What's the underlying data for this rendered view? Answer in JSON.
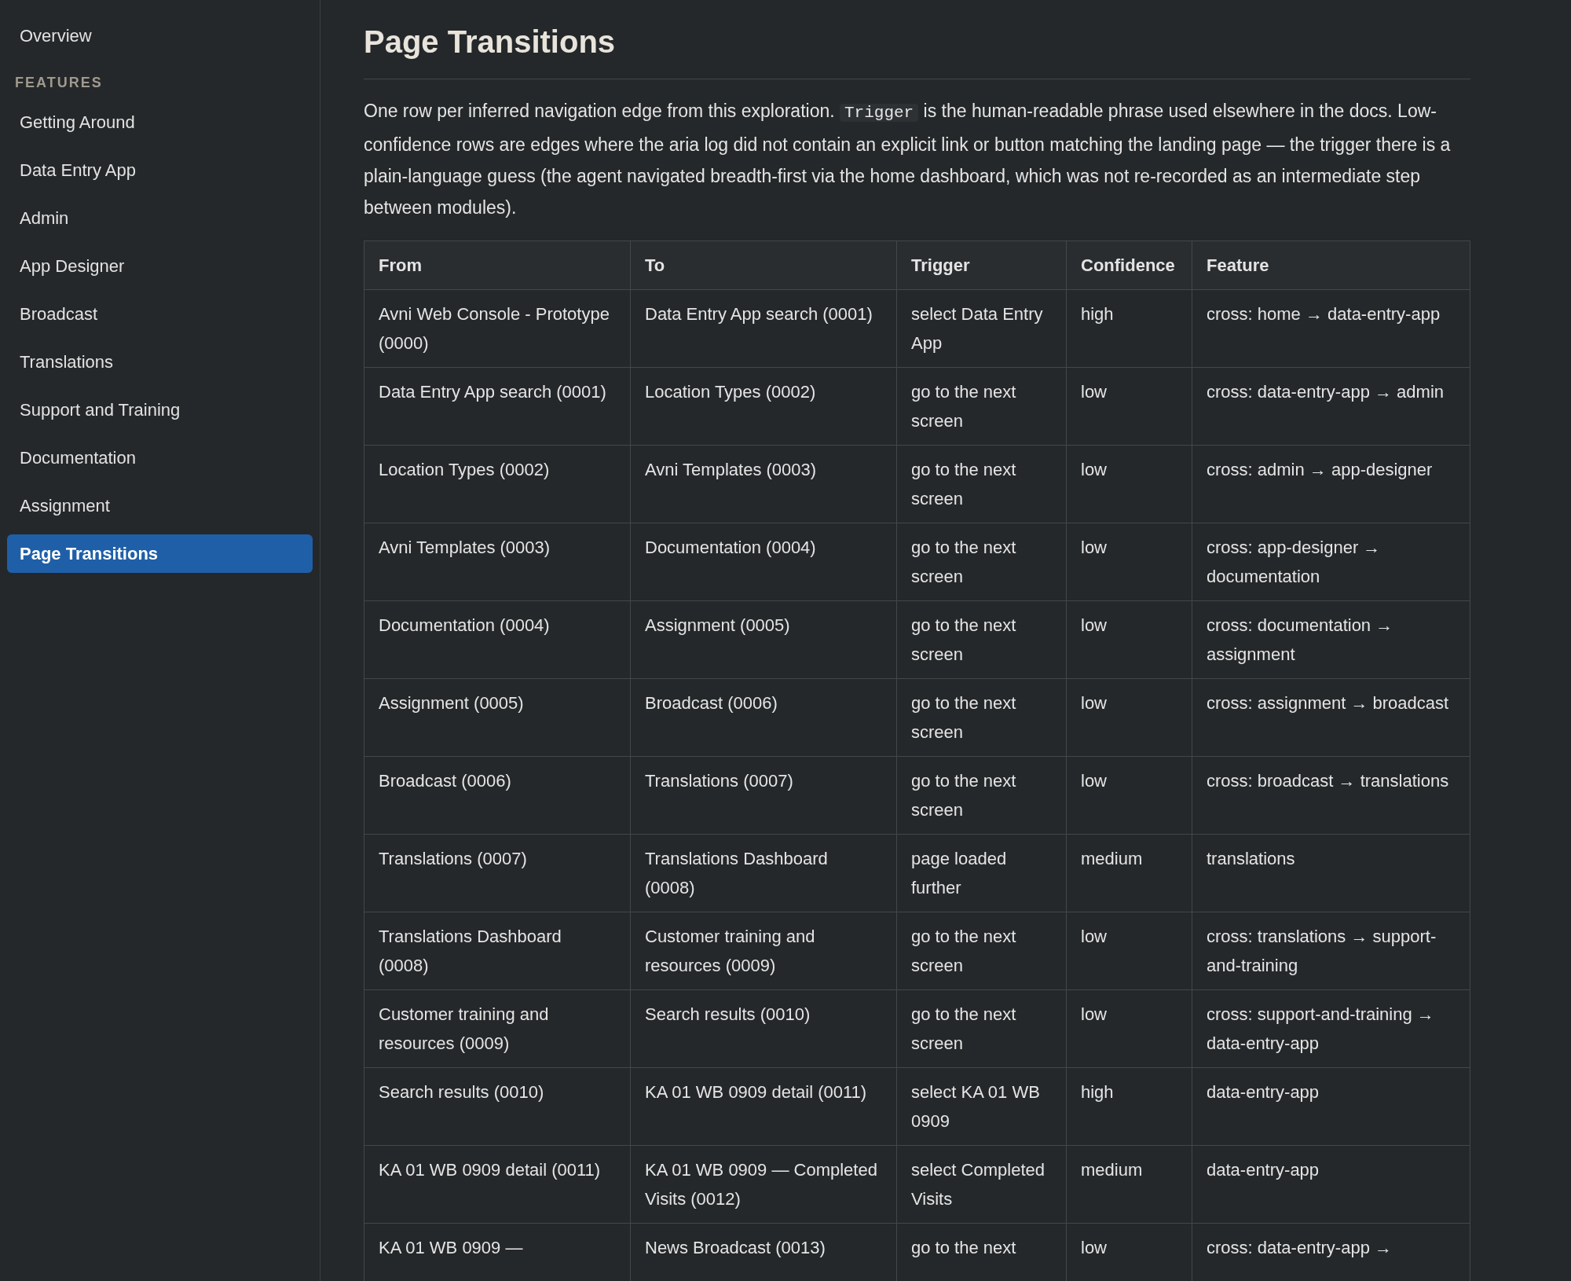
{
  "sidebar": {
    "items": [
      {
        "label": "Overview",
        "selected": false
      }
    ],
    "section_title": "FEATURES",
    "feature_items": [
      {
        "label": "Getting Around",
        "selected": false
      },
      {
        "label": "Data Entry App",
        "selected": false
      },
      {
        "label": "Admin",
        "selected": false
      },
      {
        "label": "App Designer",
        "selected": false
      },
      {
        "label": "Broadcast",
        "selected": false
      },
      {
        "label": "Translations",
        "selected": false
      },
      {
        "label": "Support and Training",
        "selected": false
      },
      {
        "label": "Documentation",
        "selected": false
      },
      {
        "label": "Assignment",
        "selected": false
      },
      {
        "label": "Page Transitions",
        "selected": true
      }
    ]
  },
  "page": {
    "title": "Page Transitions",
    "intro_before": "One row per inferred navigation edge from this exploration.",
    "intro_code": "Trigger",
    "intro_after": "is the human-readable phrase used elsewhere in the docs. Low-confidence rows are edges where the aria log did not contain an explicit link or button matching the landing page — the trigger there is a plain-language guess (the agent navigated breadth-first via the home dashboard, which was not re-recorded as an intermediate step between modules).",
    "table": {
      "columns": [
        "From",
        "To",
        "Trigger",
        "Confidence",
        "Feature"
      ],
      "rows": [
        [
          "Avni Web Console - Prototype (0000)",
          "Data Entry App search (0001)",
          "select Data Entry App",
          "high",
          "cross: home → data-entry-app"
        ],
        [
          "Data Entry App search (0001)",
          "Location Types (0002)",
          "go to the next screen",
          "low",
          "cross: data-entry-app → admin"
        ],
        [
          "Location Types (0002)",
          "Avni Templates (0003)",
          "go to the next screen",
          "low",
          "cross: admin → app-designer"
        ],
        [
          "Avni Templates (0003)",
          "Documentation (0004)",
          "go to the next screen",
          "low",
          "cross: app-designer → documentation"
        ],
        [
          "Documentation (0004)",
          "Assignment (0005)",
          "go to the next screen",
          "low",
          "cross: documentation → assignment"
        ],
        [
          "Assignment (0005)",
          "Broadcast (0006)",
          "go to the next screen",
          "low",
          "cross: assignment → broadcast"
        ],
        [
          "Broadcast (0006)",
          "Translations (0007)",
          "go to the next screen",
          "low",
          "cross: broadcast → translations"
        ],
        [
          "Translations (0007)",
          "Translations Dashboard (0008)",
          "page loaded further",
          "medium",
          "translations"
        ],
        [
          "Translations Dashboard (0008)",
          "Customer training and resources (0009)",
          "go to the next screen",
          "low",
          "cross: translations → support-and-training"
        ],
        [
          "Customer training and resources (0009)",
          "Search results (0010)",
          "go to the next screen",
          "low",
          "cross: support-and-training → data-entry-app"
        ],
        [
          "Search results (0010)",
          "KA 01 WB 0909 detail (0011)",
          "select KA 01 WB 0909",
          "high",
          "data-entry-app"
        ],
        [
          "KA 01 WB 0909 detail (0011)",
          "KA 01 WB 0909 — Completed Visits (0012)",
          "select Completed Visits",
          "medium",
          "data-entry-app"
        ],
        [
          "KA 01 WB 0909 —",
          "News Broadcast (0013)",
          "go to the next",
          "low",
          "cross: data-entry-app →"
        ]
      ]
    }
  }
}
